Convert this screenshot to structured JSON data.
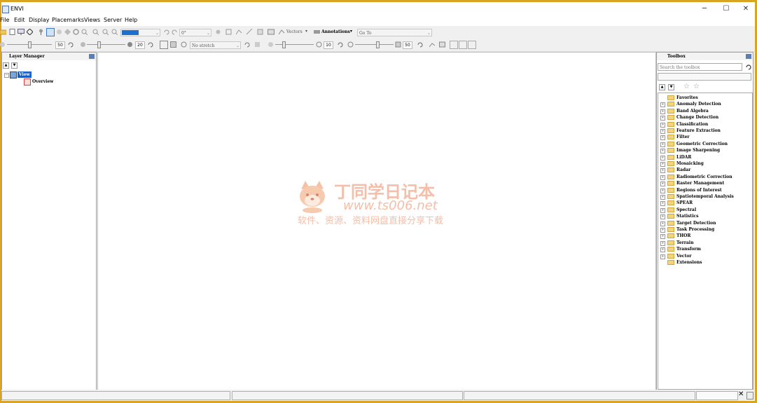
{
  "window": {
    "title": "ENVI",
    "controls": {
      "minimize": "─",
      "maximize": "☐",
      "close": "✕"
    }
  },
  "menubar": [
    "File",
    "Edit",
    "Display",
    "Placemarks",
    "Views",
    "Server",
    "Help"
  ],
  "toolbar1": {
    "rotation_value": "0°",
    "vectors_label": "Vectors",
    "annotations_label": "Annotations",
    "goto_placeholder": "Go To",
    "color_swatch": "#1f6fd0"
  },
  "toolbar2": {
    "brightness_value": "50",
    "contrast_value": "20",
    "stretch_value": "No stretch",
    "sharpen_value": "10",
    "transparency_value": "50"
  },
  "layer_manager": {
    "title": "Layer Manager",
    "root": "View",
    "child": "Overview"
  },
  "toolbox": {
    "title": "Toolbox",
    "search_placeholder": "Search the toolbox",
    "items": [
      {
        "label": "Favorites",
        "expandable": false
      },
      {
        "label": "Anomaly Detection",
        "expandable": true
      },
      {
        "label": "Band Algebra",
        "expandable": true
      },
      {
        "label": "Change Detection",
        "expandable": true
      },
      {
        "label": "Classification",
        "expandable": true
      },
      {
        "label": "Feature Extraction",
        "expandable": true
      },
      {
        "label": "Filter",
        "expandable": true
      },
      {
        "label": "Geometric Correction",
        "expandable": true
      },
      {
        "label": "Image Sharpening",
        "expandable": true
      },
      {
        "label": "LiDAR",
        "expandable": true
      },
      {
        "label": "Mosaicking",
        "expandable": true
      },
      {
        "label": "Radar",
        "expandable": true
      },
      {
        "label": "Radiometric Correction",
        "expandable": true
      },
      {
        "label": "Raster Management",
        "expandable": true
      },
      {
        "label": "Regions of Interest",
        "expandable": true
      },
      {
        "label": "Spatiotemporal Analysis",
        "expandable": true
      },
      {
        "label": "SPEAR",
        "expandable": true
      },
      {
        "label": "Spectral",
        "expandable": true
      },
      {
        "label": "Statistics",
        "expandable": true
      },
      {
        "label": "Target Detection",
        "expandable": true
      },
      {
        "label": "Task Processing",
        "expandable": true
      },
      {
        "label": "THOR",
        "expandable": true
      },
      {
        "label": "Terrain",
        "expandable": true
      },
      {
        "label": "Transform",
        "expandable": true
      },
      {
        "label": "Vector",
        "expandable": true
      },
      {
        "label": "Extensions",
        "expandable": false
      }
    ]
  },
  "watermark": {
    "title": "丁同学日记本",
    "url": "www.ts006.net",
    "tagline": "软件、资源、资料网盘直接分享下载"
  }
}
